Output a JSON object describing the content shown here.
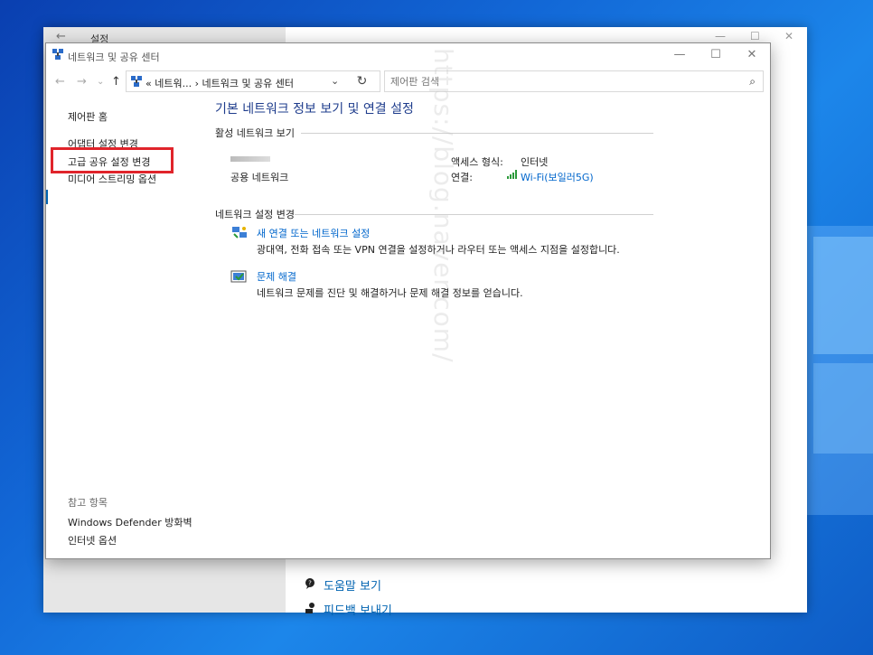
{
  "settings_window": {
    "title": "설정",
    "help_link": "도움말 보기",
    "feedback_link": "피드백 보내기"
  },
  "window": {
    "title": "네트워크 및 공유 센터",
    "minimize": "—",
    "maximize": "☐",
    "close": "✕"
  },
  "nav": {
    "back": "←",
    "forward": "→",
    "recent": "⌄",
    "up": "↑",
    "address": "« 네트워... › 네트워크 및 공유 센터",
    "dropdown": "⌄",
    "refresh": "↻",
    "search_placeholder": "제어판 검색",
    "search_icon": "⌕"
  },
  "sidebar": {
    "home": "제어판 홈",
    "items": [
      "어댑터 설정 변경",
      "고급 공유 설정 변경",
      "미디어 스트리밍 옵션"
    ],
    "see_also_header": "참고 항목",
    "see_also": [
      "Windows Defender 방화벽",
      "인터넷 옵션"
    ]
  },
  "main": {
    "title": "기본 네트워크 정보 보기 및 연결 설정",
    "active_networks_label": "활성 네트워크 보기",
    "network_type": "공용 네트워크",
    "access_type_label": "액세스 형식:",
    "access_type_value": "인터넷",
    "connections_label": "연결:",
    "connection_value": "Wi-Fi(보일러5G)",
    "change_settings_label": "네트워크 설정 변경",
    "tasks": [
      {
        "link": "새 연결 또는 네트워크 설정",
        "desc": "광대역, 전화 접속 또는 VPN 연결을 설정하거나 라우터 또는 액세스 지점을 설정합니다."
      },
      {
        "link": "문제 해결",
        "desc": "네트워크 문제를 진단 및 해결하거나 문제 해결 정보를 얻습니다."
      }
    ]
  },
  "watermark": "https://blog.naver.com/",
  "colors": {
    "highlight_box": "#e0242b",
    "link": "#0066cc",
    "title": "#1e3c8c"
  }
}
